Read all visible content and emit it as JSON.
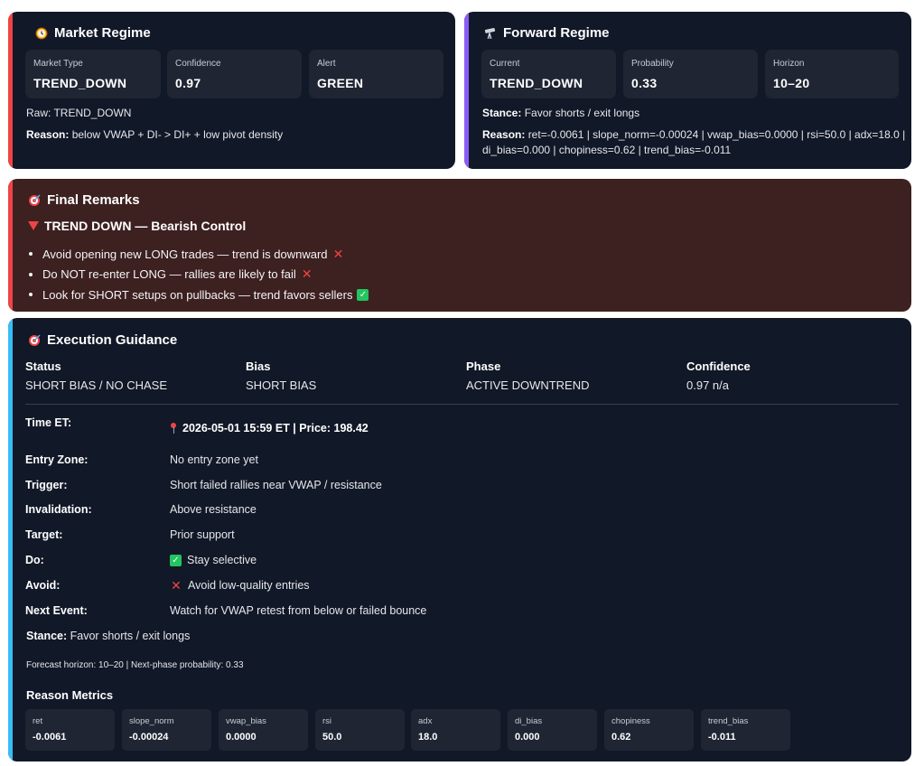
{
  "colors": {
    "card_bg": "#111827",
    "market_accent": "#ef4444",
    "forward_accent": "#8b5cf6",
    "remarks_accent": "#ef4444",
    "remarks_bg": "#3d2020",
    "exec_accent": "#38bdf8"
  },
  "market_regime": {
    "icon": "clock-icon",
    "title": "Market Regime",
    "tiles": [
      {
        "label": "Market Type",
        "value": "TREND_DOWN"
      },
      {
        "label": "Confidence",
        "value": "0.97"
      },
      {
        "label": "Alert",
        "value": "GREEN"
      }
    ],
    "raw_label": "Raw:",
    "raw_value": "TREND_DOWN",
    "reason_label": "Reason:",
    "reason_value": "below VWAP + DI- > DI+ + low pivot density"
  },
  "forward_regime": {
    "icon": "telescope-icon",
    "title": "Forward Regime",
    "tiles": [
      {
        "label": "Current",
        "value": "TREND_DOWN"
      },
      {
        "label": "Probability",
        "value": "0.33"
      },
      {
        "label": "Horizon",
        "value": "10–20"
      }
    ],
    "stance_label": "Stance:",
    "stance_value": "Favor shorts / exit longs",
    "reason_label": "Reason:",
    "reason_line1": "ret=-0.0061 | slope_norm=-0.00024 | vwap_bias=0.0000 | rsi=50.0 | adx=18.0 |",
    "reason_line2": "di_bias=0.000 | chopiness=0.62 | trend_bias=-0.011"
  },
  "final_remarks": {
    "icon": "target-icon",
    "title": "Final Remarks",
    "headline": "TREND DOWN — Bearish Control",
    "bullets": [
      {
        "text": "Avoid opening new LONG trades — trend is downward",
        "mark": "cross-icon"
      },
      {
        "text": "Do NOT re-enter LONG — rallies are likely to fail",
        "mark": "cross-icon"
      },
      {
        "text": "Look for SHORT setups on pullbacks — trend favors sellers",
        "mark": "check-icon"
      }
    ]
  },
  "execution": {
    "icon": "target-icon",
    "title": "Execution Guidance",
    "summary": [
      {
        "label": "Status",
        "value": "SHORT BIAS / NO CHASE"
      },
      {
        "label": "Bias",
        "value": "SHORT BIAS"
      },
      {
        "label": "Phase",
        "value": "ACTIVE DOWNTREND"
      },
      {
        "label": "Confidence",
        "value": "0.97 n/a"
      }
    ],
    "time_label": "Time ET:",
    "time_value": "2026-05-01 15:59 ET | Price: 198.42",
    "rows": [
      {
        "label": "Entry Zone:",
        "value": "No entry zone yet"
      },
      {
        "label": "Trigger:",
        "value": "Short failed rallies near VWAP / resistance"
      },
      {
        "label": "Invalidation:",
        "value": "Above resistance"
      },
      {
        "label": "Target:",
        "value": "Prior support"
      },
      {
        "label": "Do:",
        "value": "Stay selective"
      },
      {
        "label": "Avoid:",
        "value": "Avoid low-quality entries"
      },
      {
        "label": "Next Event:",
        "value": "Watch for VWAP retest from below or failed bounce"
      }
    ],
    "stance_label": "Stance:",
    "stance_value": "Favor shorts / exit longs",
    "forecast": "Forecast horizon: 10–20 | Next-phase probability: 0.33",
    "metrics_title": "Reason Metrics",
    "metrics": [
      {
        "label": "ret",
        "value": "-0.0061"
      },
      {
        "label": "slope_norm",
        "value": "-0.00024"
      },
      {
        "label": "vwap_bias",
        "value": "0.0000"
      },
      {
        "label": "rsi",
        "value": "50.0"
      },
      {
        "label": "adx",
        "value": "18.0"
      },
      {
        "label": "di_bias",
        "value": "0.000"
      },
      {
        "label": "chopiness",
        "value": "0.62"
      },
      {
        "label": "trend_bias",
        "value": "-0.011"
      }
    ]
  }
}
